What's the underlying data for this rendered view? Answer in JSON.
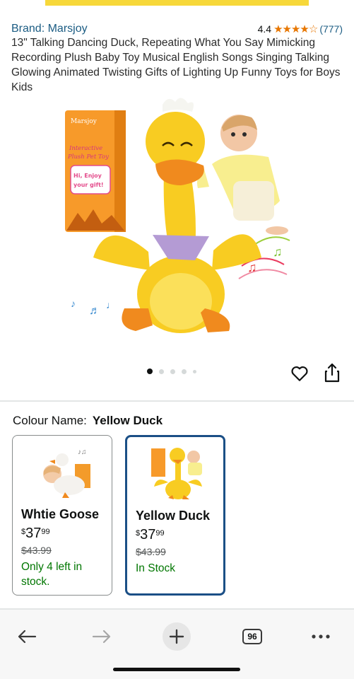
{
  "product": {
    "brand": "Brand: Marsjoy",
    "rating": "4.4",
    "stars": "★★★★☆",
    "review_count": "(777)",
    "title": "13\" Talking Dancing Duck, Repeating What You Say Mimicking Recording Plush Baby Toy Musical English Songs Singing Talking Glowing Animated Twisting Gifts of Lighting Up Funny Toys for Boys Kids"
  },
  "gallery": {
    "image_icon": "product-photo-duck-toy",
    "box_text": [
      "Marsjoy",
      "Interactive",
      "Plush Pet Toy",
      "Hi, Enjoy",
      "your gift!"
    ],
    "page_count": 5,
    "active_page": 1
  },
  "colour": {
    "label": "Colour Name:",
    "value": "Yellow Duck",
    "options": [
      {
        "name": "Whtie Goose",
        "currency": "$",
        "whole": "37",
        "fraction": "99",
        "old_price": "$43.99",
        "stock": "Only 4 left in stock.",
        "selected": false
      },
      {
        "name": "Yellow Duck",
        "currency": "$",
        "whole": "37",
        "fraction": "99",
        "old_price": "$43.99",
        "stock": "In Stock",
        "selected": true
      }
    ]
  },
  "navbar": {
    "tab_count": "96",
    "icons": [
      "back-arrow-icon",
      "forward-arrow-icon",
      "plus-icon",
      "tabs-icon",
      "more-icon"
    ]
  },
  "colors": {
    "link": "#1b5c83",
    "star": "#e77600",
    "in_stock": "#007600",
    "selected_border": "#1b4f86"
  }
}
